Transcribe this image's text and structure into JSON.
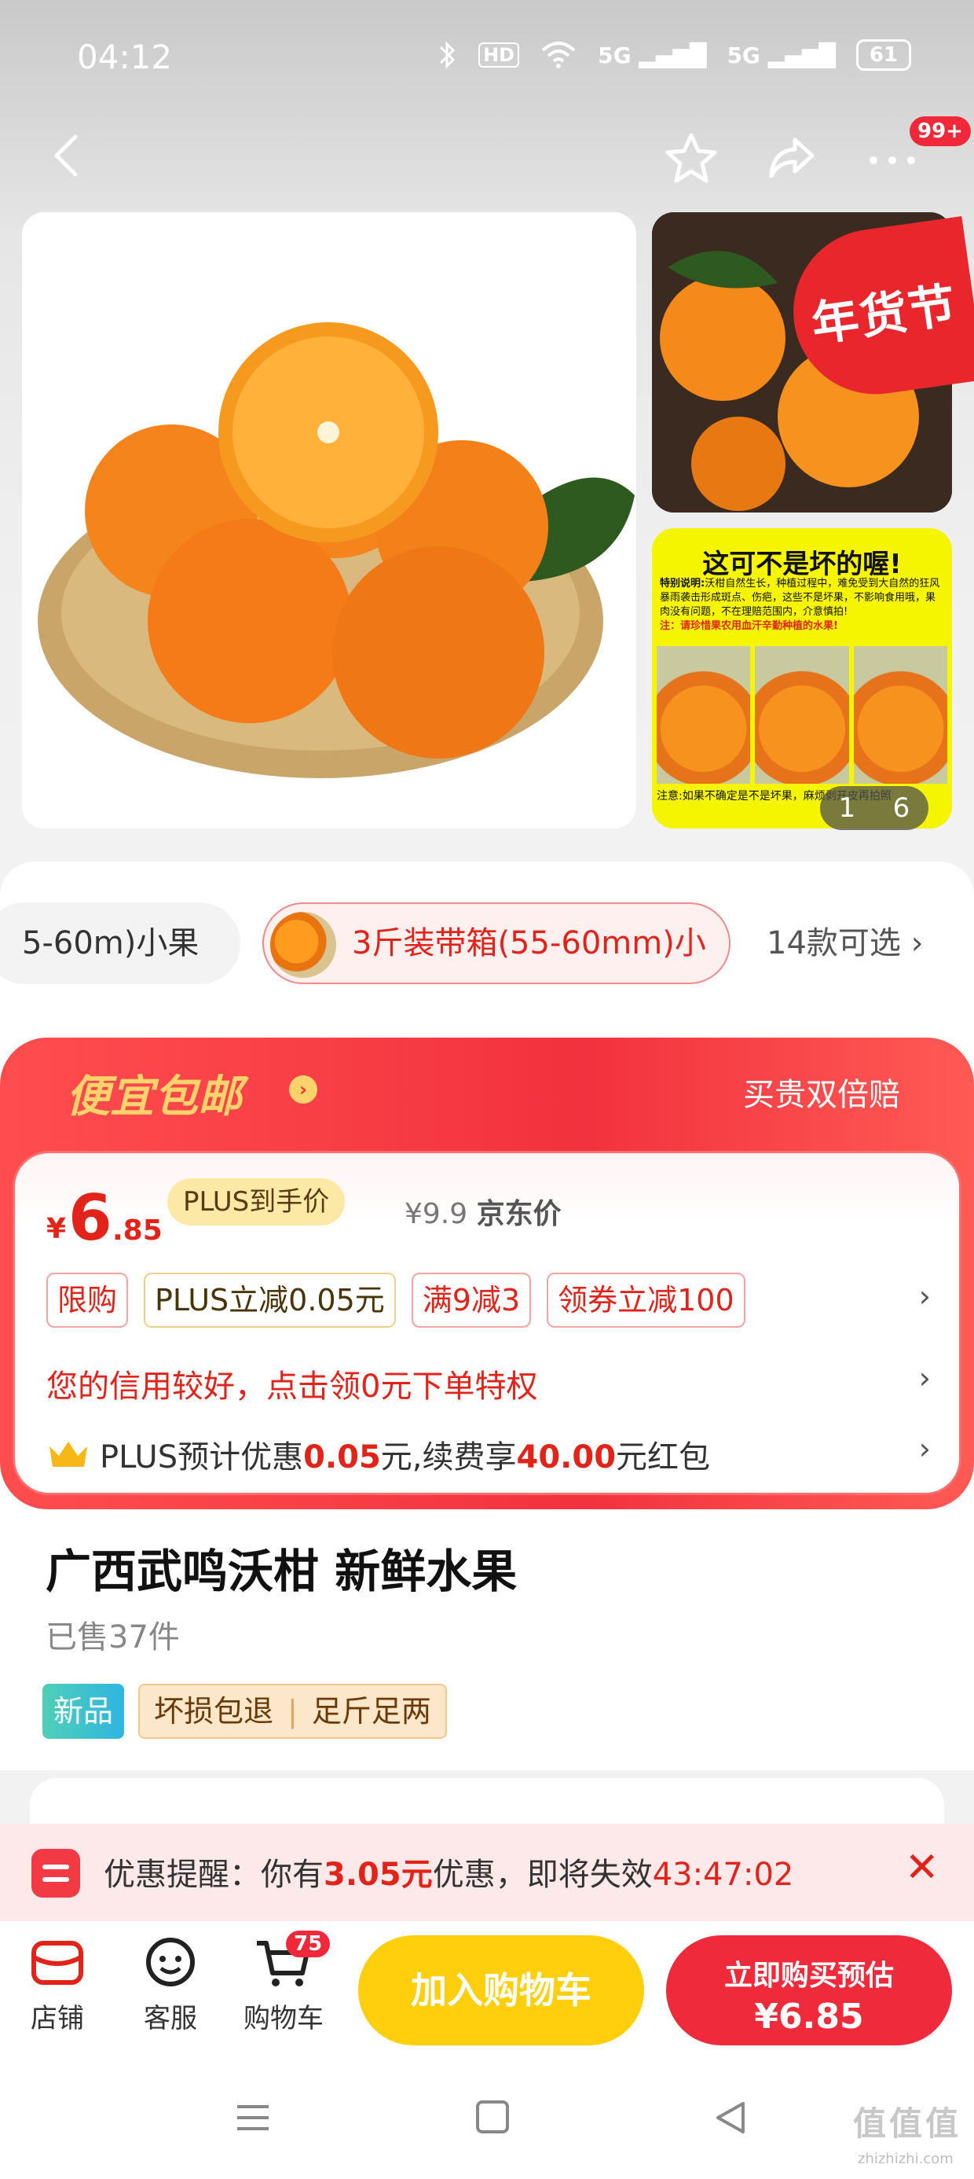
{
  "status_bar": {
    "time": "04:12",
    "icons": [
      "bluetooth-icon",
      "hd-icon",
      "wifi-icon",
      "5g-signal-icon",
      "5g-signal-icon"
    ],
    "hd_label": "HD",
    "net1": "5G",
    "net2": "5G",
    "battery": "61"
  },
  "nav": {
    "icons": [
      "back-icon",
      "star-icon",
      "share-icon",
      "more-icon"
    ],
    "message_badge": "99+"
  },
  "gallery": {
    "counter_current": "1",
    "counter_total": "6",
    "festival_badge": "年货节",
    "thumb2_title": "这可不是坏的喔!",
    "thumb2_label": "特别说明:",
    "thumb2_body": "沃柑自然生长，种植过程中，难免受到大自然的狂风暴雨袭击形成斑点、伤疤，这些不是坏果，不影响食用哦，果肉没有问题，不在理赔范围内，介意慎拍!",
    "thumb2_notice": "注：请珍惜果农用血汗辛勤种植的水果!",
    "thumb2_footer": "注意:如果不确定是不是坏果，麻烦剥开皮再拍照"
  },
  "variants": {
    "left_option": "5-60m)小果",
    "selected_option": "3斤装带箱(55-60mm)小",
    "more": "14款可选",
    "more_icon": "chevron-right-icon"
  },
  "promo": {
    "title": "便宜包邮",
    "guarantee": "买贵双倍赔",
    "price_symbol": "¥",
    "price_int": "6",
    "price_dec": ".85",
    "plus_label": "PLUS到手价",
    "jd_price": "¥9.9",
    "jd_price_label": "京东价",
    "tags": [
      "限购",
      "PLUS立减0.05元",
      "满9减3",
      "领券立减100"
    ],
    "credit_text": "您的信用较好，点击领0元下单特权",
    "plus_prefix": "PLUS预计优惠",
    "plus_amount": "0.05",
    "plus_mid": "元,续费享",
    "plus_redpack": "40.00",
    "plus_suffix": "元红包"
  },
  "product": {
    "title": "广西武鸣沃柑 新鲜水果",
    "sold": "已售37件",
    "badge_new": "新品",
    "service1": "坏损包退",
    "service2": "足斤足两"
  },
  "reminder": {
    "prefix": "优惠提醒：你有",
    "amount": "3.05元",
    "mid": "优惠，即将失效",
    "countdown": "43:47:02"
  },
  "bottom_bar": {
    "store": "店铺",
    "service": "客服",
    "cart": "购物车",
    "cart_count": "75",
    "add_to_cart": "加入购物车",
    "buy_now": "立即购买预估",
    "buy_price": "¥6.85"
  },
  "watermark": {
    "main": "值值值",
    "sub": "zhizhizhi.com"
  },
  "colors": {
    "accent_red": "#e2231a",
    "buy_button": "#ee2a3b",
    "cart_button": "#ffcf0d",
    "promo_gold": "#ffd36b"
  }
}
